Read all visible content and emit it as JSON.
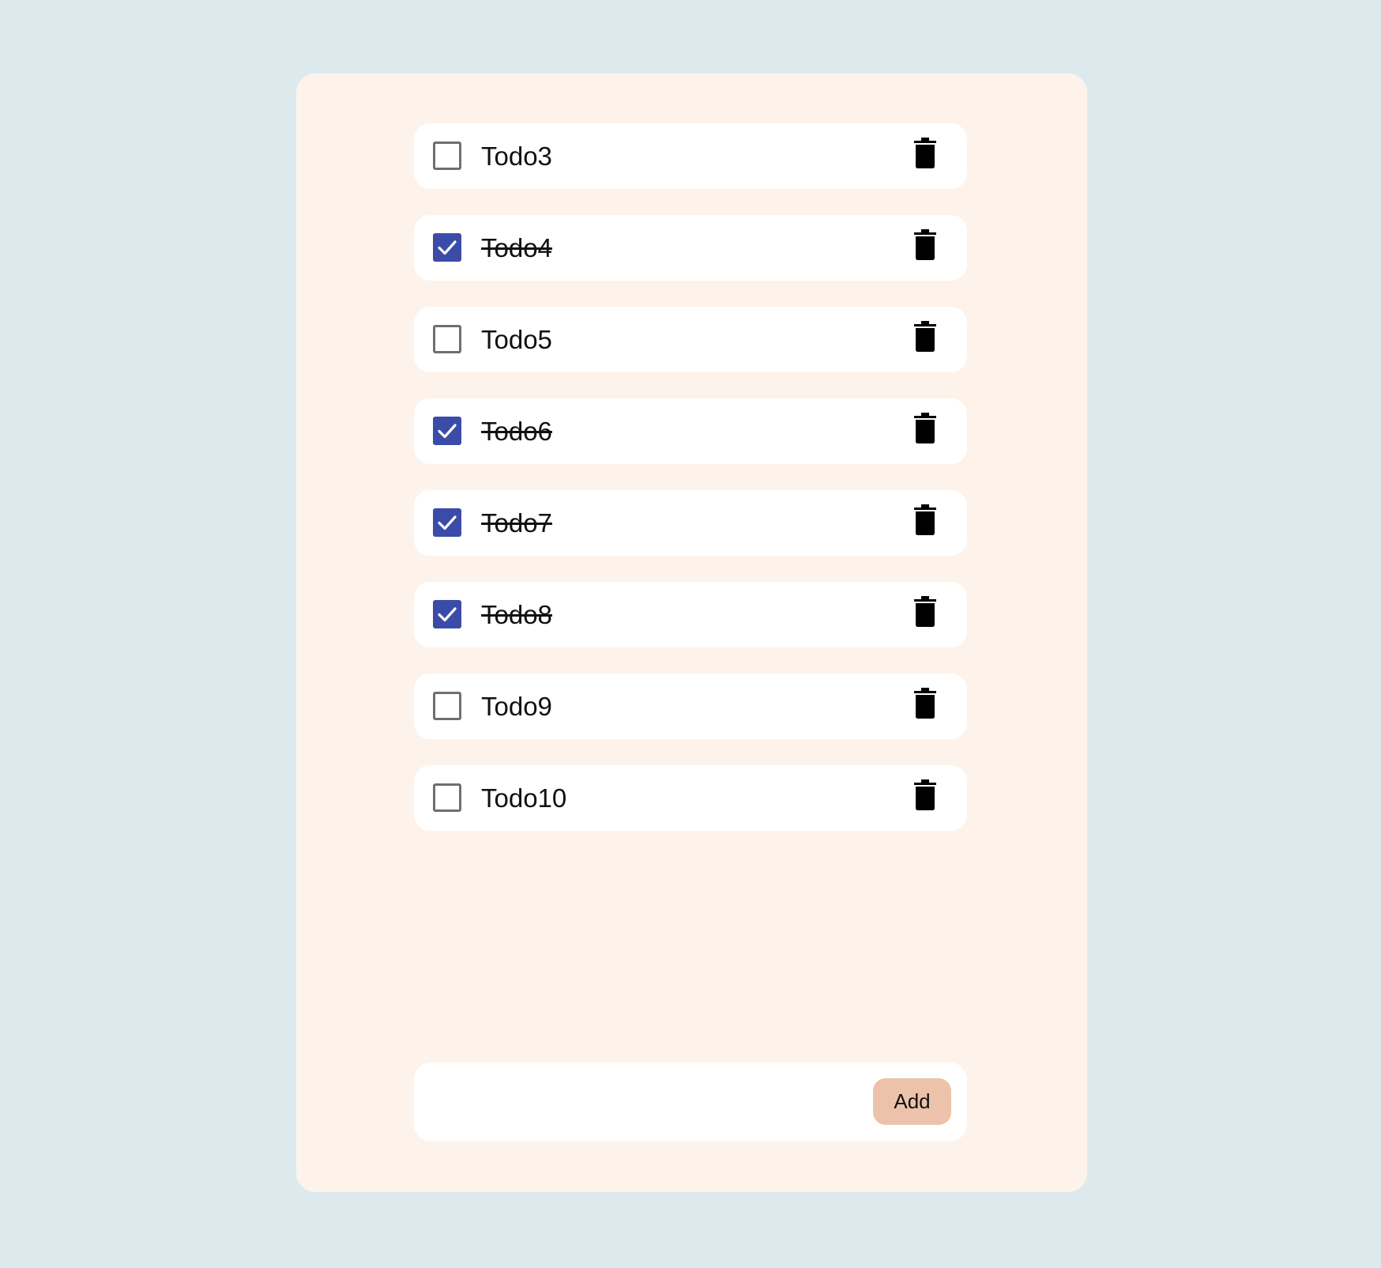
{
  "todos": [
    {
      "label": "Todo3",
      "done": false
    },
    {
      "label": "Todo4",
      "done": true
    },
    {
      "label": "Todo5",
      "done": false
    },
    {
      "label": "Todo6",
      "done": true
    },
    {
      "label": "Todo7",
      "done": true
    },
    {
      "label": "Todo8",
      "done": true
    },
    {
      "label": "Todo9",
      "done": false
    },
    {
      "label": "Todo10",
      "done": false
    }
  ],
  "add_form": {
    "input_value": "",
    "button_label": "Add"
  },
  "colors": {
    "background": "#dceaed",
    "card": "#fdf3ea",
    "checkbox_checked": "#3b4ca8",
    "add_button": "#ecc3aa"
  },
  "icons": {
    "delete": "trash-icon",
    "check": "checkmark-icon"
  }
}
